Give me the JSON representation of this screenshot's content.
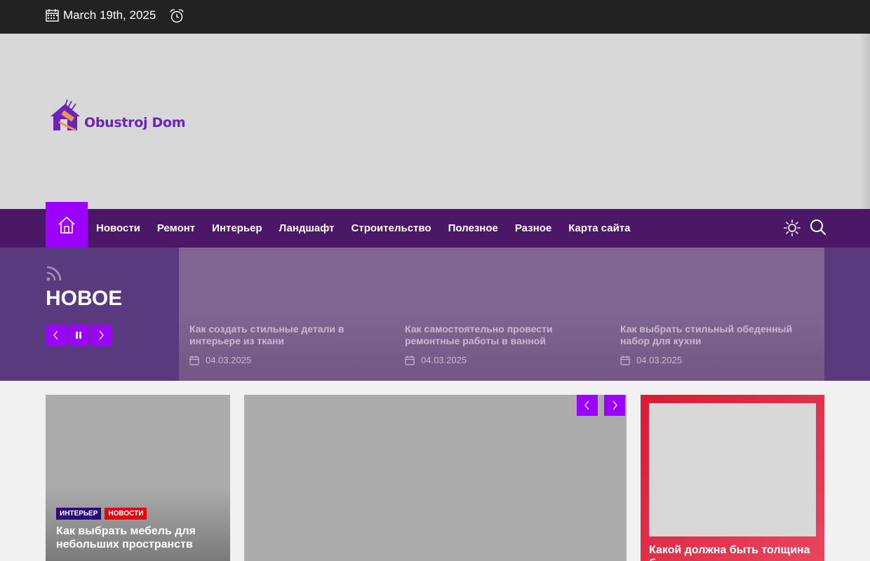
{
  "topbar": {
    "date": "March 19th, 2025"
  },
  "header": {
    "logo_text": "Obustroj Dom"
  },
  "nav": {
    "items": [
      "Новости",
      "Ремонт",
      "Интерьер",
      "Ландшафт",
      "Строительство",
      "Полезное",
      "Разное",
      "Карта сайта"
    ]
  },
  "ticker": {
    "title": "НОВОЕ",
    "items": [
      {
        "title": "Как создать стильные детали в интерьере из ткани",
        "date": "04.03.2025"
      },
      {
        "title": "Как самостоятельно провести ремонтные работы в ванной",
        "date": "04.03.2025"
      },
      {
        "title": "Как выбрать стильный обеденный набор для кухни",
        "date": "04.03.2025"
      }
    ]
  },
  "featured": {
    "left": {
      "tags": [
        {
          "label": "ИНТЕРЬЕР",
          "color": "#2b0a7a"
        },
        {
          "label": "НОВОСТИ",
          "color": "#e30613"
        }
      ],
      "title": "Как выбрать мебель для небольших пространств"
    },
    "right": {
      "title": "Какой должна быть толщина б"
    }
  },
  "colors": {
    "accent": "#9b00ff",
    "nav_bg": "#4a1866",
    "topbar_bg": "#222222",
    "tag_red": "#e30613",
    "tag_navy": "#2b0a7a",
    "card_red": "#d91a35"
  }
}
